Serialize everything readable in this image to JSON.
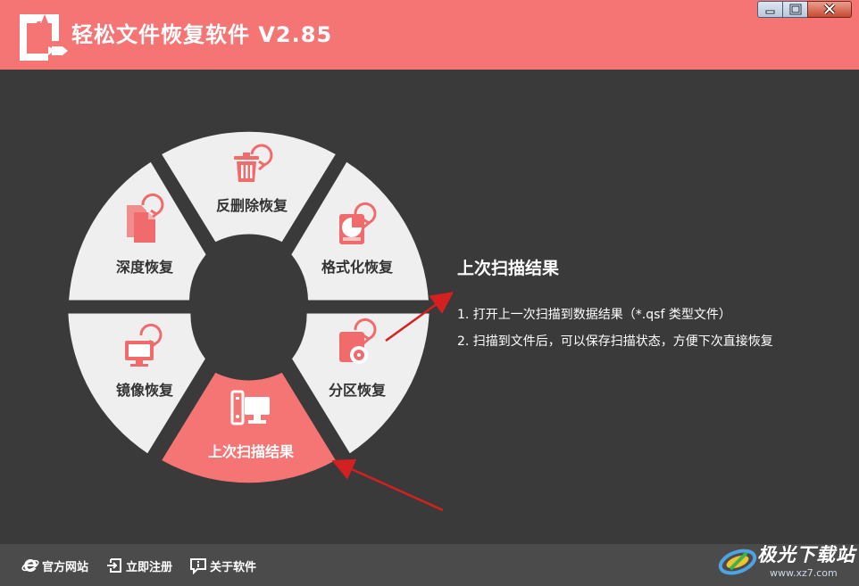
{
  "app": {
    "title": "轻松文件恢复软件 V2.85"
  },
  "window_controls": [
    "minimize",
    "maximize",
    "close"
  ],
  "wheel": {
    "segments": [
      {
        "id": "undelete",
        "label": "反删除恢复",
        "icon": "trash-restore-icon",
        "active": false
      },
      {
        "id": "format",
        "label": "格式化恢复",
        "icon": "disk-format-icon",
        "active": false
      },
      {
        "id": "partition",
        "label": "分区恢复",
        "icon": "partition-disk-icon",
        "active": false
      },
      {
        "id": "last-scan",
        "label": "上次扫描结果",
        "icon": "computer-icon",
        "active": true
      },
      {
        "id": "mirror",
        "label": "镜像恢复",
        "icon": "monitor-restore-icon",
        "active": false
      },
      {
        "id": "deep",
        "label": "深度恢复",
        "icon": "documents-restore-icon",
        "active": false
      }
    ]
  },
  "info": {
    "heading": "上次扫描结果",
    "lines": [
      "1. 打开上一次扫描到数据结果（*.qsf 类型文件）",
      "2. 扫描到文件后，可以保存扫描状态，方便下次直接恢复"
    ]
  },
  "footer": {
    "links": [
      {
        "label": "官方网站",
        "icon": "ie-icon"
      },
      {
        "label": "立即注册",
        "icon": "login-icon"
      },
      {
        "label": "关于软件",
        "icon": "info-icon"
      }
    ]
  },
  "watermark": {
    "text": "极光下载站",
    "url": "www.xz7.com"
  },
  "colors": {
    "titlebar": "#f57474",
    "background": "#3a3a3a",
    "segment": "#efefef",
    "active_segment": "#f57474",
    "accent_icon": "#f06c6c",
    "arrow": "#d42020",
    "footer": "#4b4b4b"
  }
}
